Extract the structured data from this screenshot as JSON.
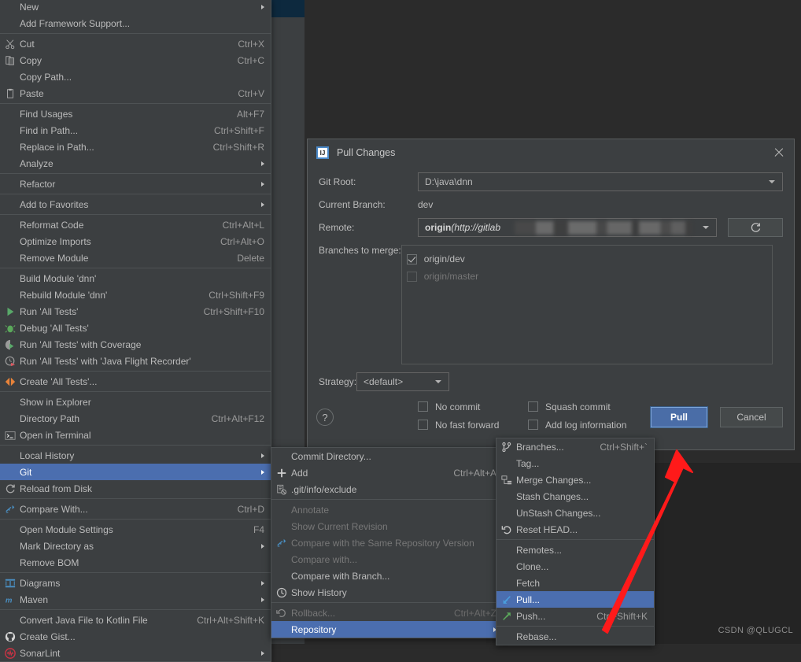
{
  "watermark": "CSDN @QLUGCL",
  "context_menu": {
    "name": "project-context-menu",
    "items": [
      {
        "label": "New",
        "accel": "",
        "icon": "",
        "submenu": true
      },
      {
        "label": "Add Framework Support...",
        "accel": "",
        "icon": "",
        "submenu": false
      },
      {
        "sep": true
      },
      {
        "label": "Cut",
        "accel": "Ctrl+X",
        "icon": "scissors-icon",
        "submenu": false
      },
      {
        "label": "Copy",
        "accel": "Ctrl+C",
        "icon": "copy-icon",
        "submenu": false
      },
      {
        "label": "Copy Path...",
        "accel": "",
        "icon": "",
        "submenu": false
      },
      {
        "label": "Paste",
        "accel": "Ctrl+V",
        "icon": "clipboard-icon",
        "submenu": false
      },
      {
        "sep": true
      },
      {
        "label": "Find Usages",
        "accel": "Alt+F7",
        "icon": "",
        "submenu": false
      },
      {
        "label": "Find in Path...",
        "accel": "Ctrl+Shift+F",
        "icon": "",
        "submenu": false
      },
      {
        "label": "Replace in Path...",
        "accel": "Ctrl+Shift+R",
        "icon": "",
        "submenu": false
      },
      {
        "label": "Analyze",
        "accel": "",
        "icon": "",
        "submenu": true
      },
      {
        "sep": true
      },
      {
        "label": "Refactor",
        "accel": "",
        "icon": "",
        "submenu": true
      },
      {
        "sep": true
      },
      {
        "label": "Add to Favorites",
        "accel": "",
        "icon": "",
        "submenu": true
      },
      {
        "sep": true
      },
      {
        "label": "Reformat Code",
        "accel": "Ctrl+Alt+L",
        "icon": "",
        "submenu": false
      },
      {
        "label": "Optimize Imports",
        "accel": "Ctrl+Alt+O",
        "icon": "",
        "submenu": false
      },
      {
        "label": "Remove Module",
        "accel": "Delete",
        "icon": "",
        "submenu": false
      },
      {
        "sep": true
      },
      {
        "label": "Build Module 'dnn'",
        "accel": "",
        "icon": "",
        "submenu": false
      },
      {
        "label": "Rebuild Module 'dnn'",
        "accel": "Ctrl+Shift+F9",
        "icon": "",
        "submenu": false
      },
      {
        "label": "Run 'All Tests'",
        "accel": "Ctrl+Shift+F10",
        "icon": "run-icon",
        "submenu": false
      },
      {
        "label": "Debug 'All Tests'",
        "accel": "",
        "icon": "debug-icon",
        "submenu": false
      },
      {
        "label": "Run 'All Tests' with Coverage",
        "accel": "",
        "icon": "coverage-icon",
        "submenu": false
      },
      {
        "label": "Run 'All Tests' with 'Java Flight Recorder'",
        "accel": "",
        "icon": "flight-recorder-icon",
        "submenu": false
      },
      {
        "sep": true
      },
      {
        "label": "Create 'All Tests'...",
        "accel": "",
        "icon": "create-config-icon",
        "submenu": false
      },
      {
        "sep": true
      },
      {
        "label": "Show in Explorer",
        "accel": "",
        "icon": "",
        "submenu": false
      },
      {
        "label": "Directory Path",
        "accel": "Ctrl+Alt+F12",
        "icon": "",
        "submenu": false
      },
      {
        "label": "Open in Terminal",
        "accel": "",
        "icon": "terminal-icon",
        "submenu": false
      },
      {
        "sep": true
      },
      {
        "label": "Local History",
        "accel": "",
        "icon": "",
        "submenu": true
      },
      {
        "label": "Git",
        "accel": "",
        "icon": "",
        "submenu": true,
        "selected": true
      },
      {
        "label": "Reload from Disk",
        "accel": "",
        "icon": "reload-icon",
        "submenu": false
      },
      {
        "sep": true
      },
      {
        "label": "Compare With...",
        "accel": "Ctrl+D",
        "icon": "compare-icon",
        "submenu": false
      },
      {
        "sep": true
      },
      {
        "label": "Open Module Settings",
        "accel": "F4",
        "icon": "",
        "submenu": false
      },
      {
        "label": "Mark Directory as",
        "accel": "",
        "icon": "",
        "submenu": true
      },
      {
        "label": "Remove BOM",
        "accel": "",
        "icon": "",
        "submenu": false
      },
      {
        "sep": true
      },
      {
        "label": "Diagrams",
        "accel": "",
        "icon": "diagram-icon",
        "submenu": true
      },
      {
        "label": "Maven",
        "accel": "",
        "icon": "maven-icon",
        "submenu": true
      },
      {
        "sep": true
      },
      {
        "label": "Convert Java File to Kotlin File",
        "accel": "Ctrl+Alt+Shift+K",
        "icon": "",
        "submenu": false
      },
      {
        "label": "Create Gist...",
        "accel": "",
        "icon": "github-icon",
        "submenu": false
      },
      {
        "label": "SonarLint",
        "accel": "",
        "icon": "sonarlint-icon",
        "submenu": true
      }
    ]
  },
  "git_submenu": {
    "name": "git-submenu",
    "items": [
      {
        "label": "Commit Directory...",
        "accel": "",
        "icon": "",
        "submenu": false
      },
      {
        "label": "Add",
        "accel": "Ctrl+Alt+A",
        "icon": "plus-icon",
        "submenu": false
      },
      {
        "label": ".git/info/exclude",
        "accel": "",
        "icon": "ignore-icon",
        "submenu": false
      },
      {
        "sep": true
      },
      {
        "label": "Annotate",
        "accel": "",
        "icon": "",
        "submenu": false,
        "disabled": true
      },
      {
        "label": "Show Current Revision",
        "accel": "",
        "icon": "",
        "submenu": false,
        "disabled": true
      },
      {
        "label": "Compare with the Same Repository Version",
        "accel": "",
        "icon": "compare-icon",
        "submenu": false,
        "disabled": true
      },
      {
        "label": "Compare with...",
        "accel": "",
        "icon": "",
        "submenu": false,
        "disabled": true
      },
      {
        "label": "Compare with Branch...",
        "accel": "",
        "icon": "",
        "submenu": false
      },
      {
        "label": "Show History",
        "accel": "",
        "icon": "history-icon",
        "submenu": false
      },
      {
        "sep": true
      },
      {
        "label": "Rollback...",
        "accel": "Ctrl+Alt+Z",
        "icon": "rollback-icon",
        "submenu": false,
        "disabled": true
      },
      {
        "label": "Repository",
        "accel": "",
        "icon": "",
        "submenu": true,
        "selected": true
      }
    ]
  },
  "repository_submenu": {
    "name": "repository-submenu",
    "items": [
      {
        "label": "Branches...",
        "accel": "Ctrl+Shift+`",
        "icon": "branch-icon",
        "submenu": false
      },
      {
        "label": "Tag...",
        "accel": "",
        "icon": "",
        "submenu": false
      },
      {
        "label": "Merge Changes...",
        "accel": "",
        "icon": "merge-icon",
        "submenu": false
      },
      {
        "label": "Stash Changes...",
        "accel": "",
        "icon": "",
        "submenu": false
      },
      {
        "label": "UnStash Changes...",
        "accel": "",
        "icon": "",
        "submenu": false
      },
      {
        "label": "Reset HEAD...",
        "accel": "",
        "icon": "reset-icon",
        "submenu": false
      },
      {
        "sep": true
      },
      {
        "label": "Remotes...",
        "accel": "",
        "icon": "",
        "submenu": false
      },
      {
        "label": "Clone...",
        "accel": "",
        "icon": "",
        "submenu": false
      },
      {
        "label": "Fetch",
        "accel": "",
        "icon": "",
        "submenu": false
      },
      {
        "label": "Pull...",
        "accel": "",
        "icon": "pull-icon",
        "submenu": false,
        "selected": true
      },
      {
        "label": "Push...",
        "accel": "Ctrl+Shift+K",
        "icon": "push-icon",
        "submenu": false
      },
      {
        "sep": true
      },
      {
        "label": "Rebase...",
        "accel": "",
        "icon": "",
        "submenu": false
      }
    ]
  },
  "dialog": {
    "title": "Pull Changes",
    "icon": "intellij-idea-icon",
    "close_label": "close-icon",
    "git_root_label": "Git Root:",
    "git_root_value": "D:\\java\\dnn",
    "current_branch_label": "Current Branch:",
    "current_branch_value": "dev",
    "remote_label": "Remote:",
    "remote_value_prefix": "origin",
    "remote_value_url": "(http://gitlab",
    "refresh_icon": "refresh-icon",
    "branches_label": "Branches to merge:",
    "branches": [
      {
        "label": "origin/dev",
        "checked": true,
        "disabled": false
      },
      {
        "label": "origin/master",
        "checked": false,
        "disabled": true
      }
    ],
    "strategy_label": "Strategy:",
    "strategy_value": "<default>",
    "options": [
      {
        "label": "No commit",
        "checked": false
      },
      {
        "label": "Squash commit",
        "checked": false
      },
      {
        "label": "No fast forward",
        "checked": false
      },
      {
        "label": "Add log information",
        "checked": false
      }
    ],
    "help_label": "?",
    "pull_label": "Pull",
    "cancel_label": "Cancel",
    "accent_color": "#4a6da7"
  }
}
